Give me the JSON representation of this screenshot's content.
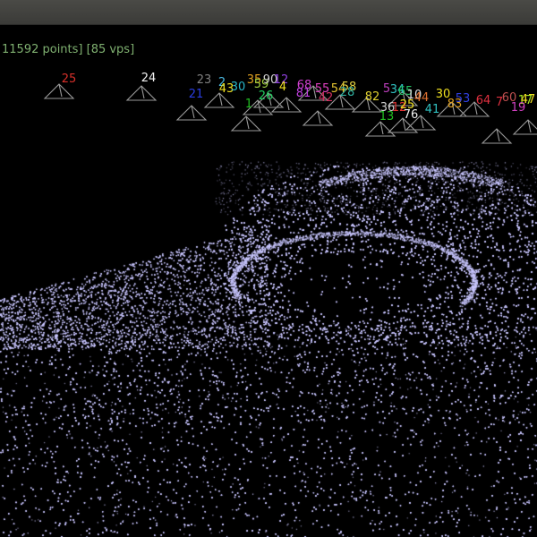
{
  "viewer": {
    "status_text": "11592 points] [85 vps]",
    "status_color": "#7fb070",
    "point_color": "#c9c6ff",
    "camera_color": "#9a9a9a"
  },
  "cameras": [
    {
      "id": "cam-25a",
      "label": "25",
      "color": "#d8302a"
    },
    {
      "id": "cam-24",
      "label": "24",
      "color": "#f2f2f2"
    },
    {
      "id": "cam-23",
      "label": "23",
      "color": "#808080"
    },
    {
      "id": "cam-21",
      "label": "21",
      "color": "#2a3de0"
    },
    {
      "id": "cam-2",
      "label": "2",
      "color": "#4ab8e0"
    },
    {
      "id": "cam-43",
      "label": "43",
      "color": "#f0e020"
    },
    {
      "id": "cam-30",
      "label": "30",
      "color": "#29b6c8"
    },
    {
      "id": "cam-1",
      "label": "1",
      "color": "#22c022"
    },
    {
      "id": "cam-35",
      "label": "35",
      "color": "#e0a020"
    },
    {
      "id": "cam-59",
      "label": "59",
      "color": "#a0d040"
    },
    {
      "id": "cam-90",
      "label": "90",
      "color": "#d0d0d0"
    },
    {
      "id": "cam-12",
      "label": "12",
      "color": "#9040e0"
    },
    {
      "id": "cam-4",
      "label": "4",
      "color": "#f0e020"
    },
    {
      "id": "cam-26",
      "label": "26",
      "color": "#22d060"
    },
    {
      "id": "cam-68",
      "label": "68",
      "color": "#d040d0"
    },
    {
      "id": "cam-81",
      "label": "81",
      "color": "#c040e0"
    },
    {
      "id": "cam-55",
      "label": "55",
      "color": "#e040c0"
    },
    {
      "id": "cam-42",
      "label": "42",
      "color": "#d03060"
    },
    {
      "id": "cam-54",
      "label": "54",
      "color": "#e0c030"
    },
    {
      "id": "cam-58",
      "label": "58",
      "color": "#e0d040"
    },
    {
      "id": "cam-28",
      "label": "28",
      "color": "#30b0a0"
    },
    {
      "id": "cam-82",
      "label": "82",
      "color": "#e0d030"
    },
    {
      "id": "cam-5",
      "label": "5",
      "color": "#c040c0"
    },
    {
      "id": "cam-34",
      "label": "34",
      "color": "#30c0c0"
    },
    {
      "id": "cam-65",
      "label": "65",
      "color": "#20c060"
    },
    {
      "id": "cam-36",
      "label": "36",
      "color": "#d0d0d0"
    },
    {
      "id": "cam-13",
      "label": "13",
      "color": "#22c022"
    },
    {
      "id": "cam-12b",
      "label": "12",
      "color": "#e03030"
    },
    {
      "id": "cam-25b",
      "label": "25",
      "color": "#f0e020"
    },
    {
      "id": "cam-76",
      "label": "76",
      "color": "#f0f0f0"
    },
    {
      "id": "cam-10",
      "label": "10",
      "color": "#e0e0e0"
    },
    {
      "id": "cam-44",
      "label": "44",
      "color": "#e07030"
    },
    {
      "id": "cam-30b",
      "label": "30",
      "color": "#f0e020"
    },
    {
      "id": "cam-41",
      "label": "41",
      "color": "#30c0c0"
    },
    {
      "id": "cam-83",
      "label": "83",
      "color": "#e0a020"
    },
    {
      "id": "cam-53",
      "label": "53",
      "color": "#3040e0"
    },
    {
      "id": "cam-64",
      "label": "64",
      "color": "#e03040"
    },
    {
      "id": "cam-7",
      "label": "7",
      "color": "#e03040"
    },
    {
      "id": "cam-60",
      "label": "60",
      "color": "#c05050"
    },
    {
      "id": "cam-17",
      "label": "17",
      "color": "#a0e020"
    },
    {
      "id": "cam-19",
      "label": "19",
      "color": "#d040c0"
    },
    {
      "id": "cam-47",
      "label": "47",
      "color": "#f0e020"
    }
  ]
}
